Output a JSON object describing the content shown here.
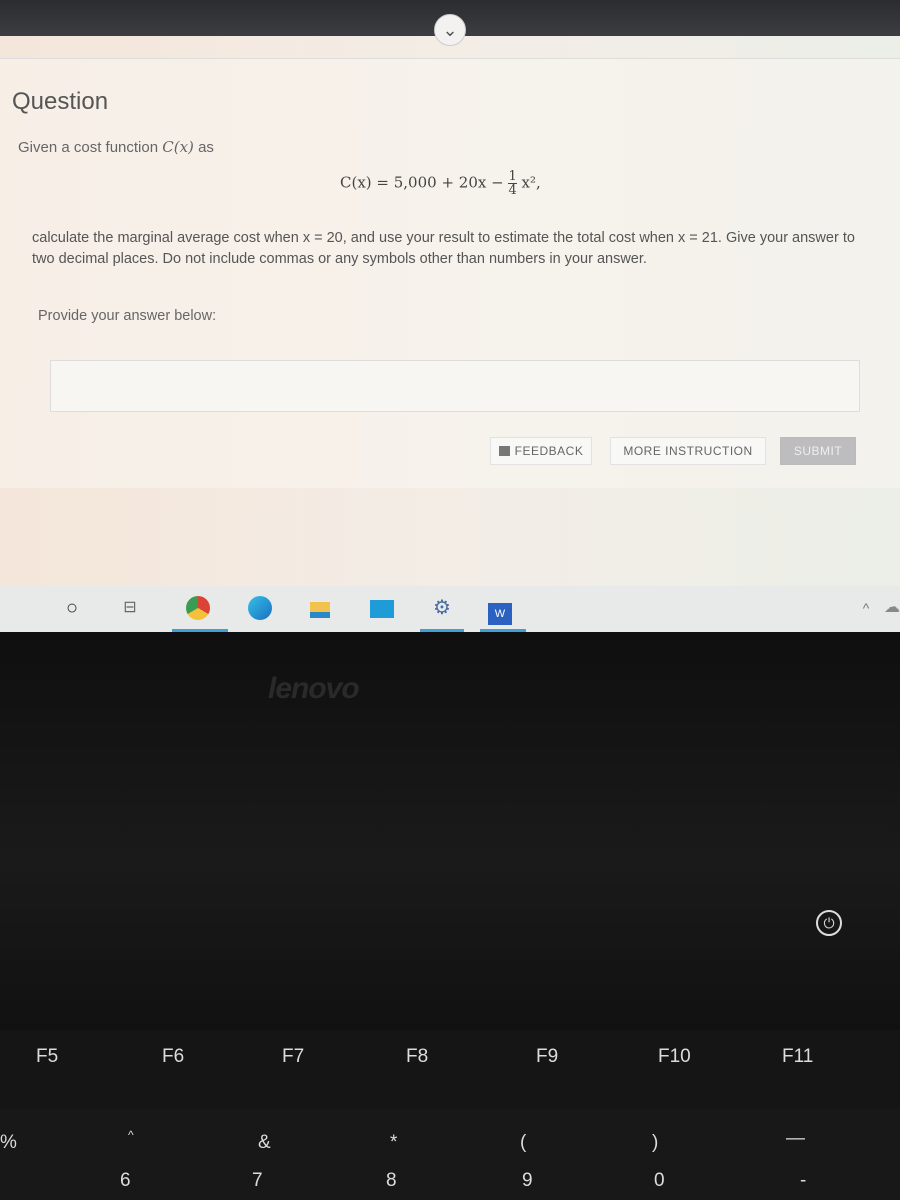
{
  "question": {
    "title": "Question",
    "intro": "Given a cost function",
    "intro_fn": "C(x)",
    "intro_end": "as",
    "formula": "C(x) = 5,000 + 20x − (1/4)x²,",
    "formula_parts": {
      "lhs": "C(x) = 5,000 + 20x −",
      "num": "1",
      "den": "4",
      "tail": "x², "
    },
    "body": "calculate the marginal average cost when x = 20, and use your result to estimate the total cost when x = 21. Give your answer to two decimal places. Do not include commas or any symbols other than numbers in your answer.",
    "provide_label": "Provide your answer below:",
    "answer_value": ""
  },
  "buttons": {
    "feedback": "FEEDBACK",
    "more_instruction": "MORE INSTRUCTION",
    "submit": "SUBMIT"
  },
  "taskbar": {
    "icons": [
      "search-icon",
      "task-view-icon",
      "chrome-icon",
      "edge-icon",
      "file-explorer-icon",
      "mail-icon",
      "settings-icon",
      "word-icon"
    ],
    "word_letter": "W"
  },
  "laptop": {
    "brand": "lenovo",
    "fkeys": [
      "F5",
      "F6",
      "F7",
      "F8",
      "F9",
      "F10",
      "F11"
    ],
    "number_keys": [
      {
        "top": "%",
        "bottom": ""
      },
      {
        "top": "^",
        "bottom": "6"
      },
      {
        "top": "&",
        "bottom": "7"
      },
      {
        "top": "*",
        "bottom": "8"
      },
      {
        "top": "(",
        "bottom": "9"
      },
      {
        "top": ")",
        "bottom": "0"
      },
      {
        "top": "—",
        "bottom": "-"
      }
    ]
  }
}
